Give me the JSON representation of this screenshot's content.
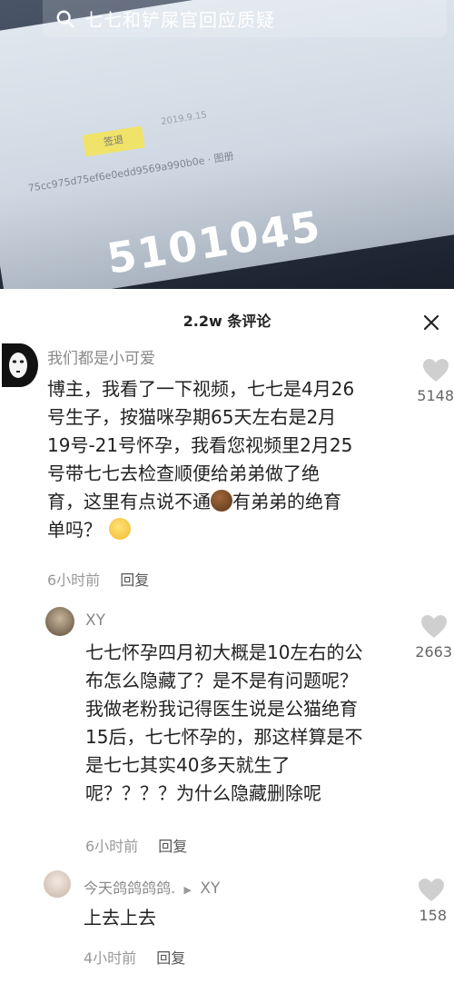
{
  "search": {
    "query": "七七和铲屎官回应质疑"
  },
  "video": {
    "tag_text": "签退",
    "date_text": "2019.9.15",
    "hash_text": "75cc975d75ef6e0edd9569a990b0e · 图册",
    "big_number": "5101045"
  },
  "comments_header": {
    "title": "2.2w 条评论"
  },
  "comments": [
    {
      "author": "我们都是小可爱",
      "lines": [
        "博主，我看了一下视频，七七是4月26",
        "号生子，按猫咪孕期65天左右是2月",
        "19号-21号怀孕，我看您视频里2月25",
        "号带七七去检查顺便给弟弟做了绝",
        "育，这里有点说不通",
        "有弟弟的绝育",
        "单吗？"
      ],
      "time": "6小时前",
      "reply_label": "回复",
      "likes": "5148"
    },
    {
      "author": "XY",
      "lines": [
        "七七怀孕四月初大概是10左右的公",
        "布怎么隐藏了？是不是有问题呢？",
        "我做老粉我记得医生说是公猫绝育",
        "15后，七七怀孕的，那这样算是不",
        "是七七其实40多天就生了",
        "呢？？？？为什么隐藏删除呢"
      ],
      "time": "6小时前",
      "reply_label": "回复",
      "likes": "2663"
    },
    {
      "author": "今天鸽鸽鸽鸽.",
      "reply_to": "XY",
      "lines": [
        "上去上去"
      ],
      "time": "4小时前",
      "reply_label": "回复",
      "likes": "158"
    }
  ]
}
